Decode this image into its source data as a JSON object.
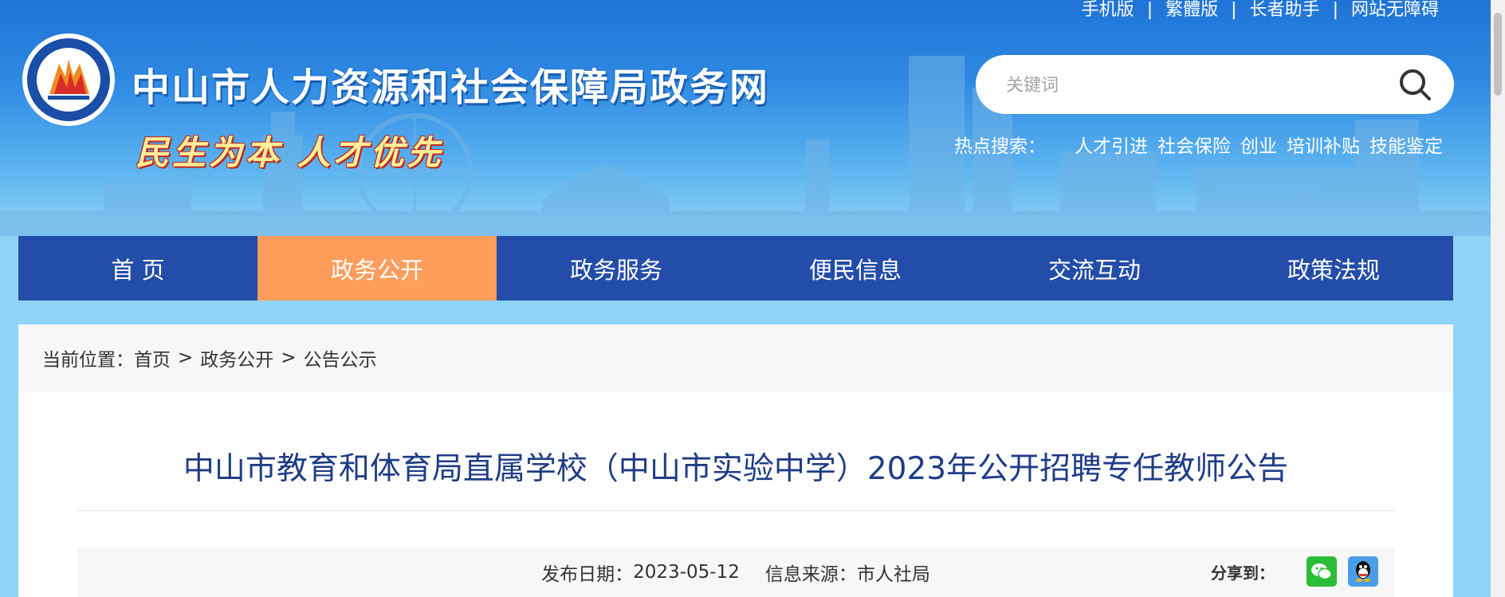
{
  "top_links": [
    "手机版",
    "繁體版",
    "长者助手",
    "网站无障碍"
  ],
  "site": {
    "title": "中山市人力资源和社会保障局政务网",
    "slogan": "民生为本 人才优先"
  },
  "search": {
    "placeholder": "关键词",
    "icon": "search-icon"
  },
  "hot_search": {
    "label": "热点搜索：",
    "items": [
      "人才引进",
      "社会保险",
      "创业",
      "培训补贴",
      "技能鉴定"
    ]
  },
  "nav": {
    "items": [
      "首 页",
      "政务公开",
      "政务服务",
      "便民信息",
      "交流互动",
      "政策法规"
    ],
    "active_index": 1
  },
  "breadcrumb": {
    "prefix": "当前位置：",
    "items": [
      "首页",
      "政务公开",
      "公告公示"
    ],
    "separator": ">"
  },
  "article": {
    "title": "中山市教育和体育局直属学校（中山市实验中学）2023年公开招聘专任教师公告",
    "date_label": "发布日期：",
    "date": "2023-05-12",
    "source_label": "信息来源：",
    "source": "市人社局",
    "share_label": "分享到：",
    "share_icons": [
      "wechat-icon",
      "qq-icon"
    ]
  },
  "colors": {
    "nav_bg": "#234da8",
    "nav_active": "#ff9d5c",
    "title_color": "#1f3d86",
    "header_top": "#1f73d6",
    "header_bottom": "#8fd4f7"
  }
}
